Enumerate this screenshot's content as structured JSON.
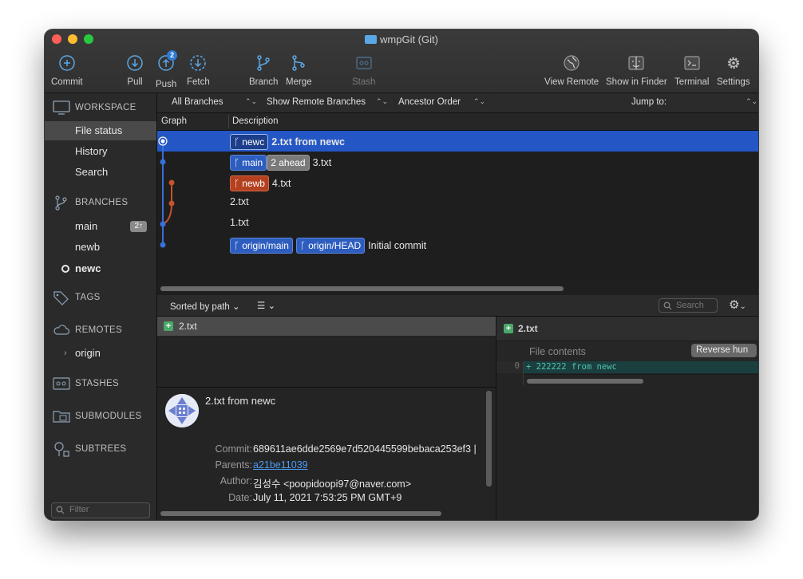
{
  "window": {
    "title": "wmpGit (Git)"
  },
  "toolbar": {
    "commit": "Commit",
    "pull": "Pull",
    "push": "Push",
    "push_badge": "2",
    "fetch": "Fetch",
    "branch": "Branch",
    "merge": "Merge",
    "stash": "Stash",
    "view_remote": "View Remote",
    "show_in_finder": "Show in Finder",
    "terminal": "Terminal",
    "settings": "Settings"
  },
  "sidebar": {
    "workspace": "WORKSPACE",
    "workspace_items": [
      "File status",
      "History",
      "Search"
    ],
    "branches": "BRANCHES",
    "branch_items": [
      {
        "name": "main",
        "badge": "2↑"
      },
      {
        "name": "newb"
      },
      {
        "name": "newc",
        "current": true
      }
    ],
    "tags": "TAGS",
    "remotes": "REMOTES",
    "remote_items": [
      "origin"
    ],
    "stashes": "STASHES",
    "submodules": "SUBMODULES",
    "subtrees": "SUBTREES",
    "filter_placeholder": "Filter"
  },
  "filters": {
    "branches": "All Branches",
    "remote": "Show Remote Branches",
    "order": "Ancestor Order",
    "jump_to": "Jump to:"
  },
  "columns": {
    "graph": "Graph",
    "description": "Description"
  },
  "commits": [
    {
      "tags": [
        {
          "label": "newc",
          "color": "blue"
        }
      ],
      "message": "2.txt from newc",
      "selected": true
    },
    {
      "tags": [
        {
          "label": "main",
          "color": "blue"
        },
        {
          "label": "2 ahead",
          "color": "gray"
        }
      ],
      "message": "3.txt"
    },
    {
      "tags": [
        {
          "label": "newb",
          "color": "red"
        }
      ],
      "message": "4.txt"
    },
    {
      "tags": [],
      "message": "2.txt"
    },
    {
      "tags": [],
      "message": "1.txt"
    },
    {
      "tags": [
        {
          "label": "origin/main",
          "color": "blue"
        },
        {
          "label": "origin/HEAD",
          "color": "blue"
        }
      ],
      "message": "Initial commit"
    }
  ],
  "files_bar": {
    "sort": "Sorted by path",
    "search_placeholder": "Search"
  },
  "files": [
    {
      "name": "2.txt",
      "status": "added"
    }
  ],
  "commit_detail": {
    "title": "2.txt from newc",
    "commit_label": "Commit:",
    "commit": "689611ae6dde2569e7d520445599bebaca253ef3 |",
    "parents_label": "Parents:",
    "parents": "a21be11039",
    "author_label": "Author:",
    "author": "김성수 <poopidoopi97@naver.com>",
    "date_label": "Date:",
    "date": "July 11, 2021 7:53:25 PM GMT+9"
  },
  "diff": {
    "file": "2.txt",
    "header": "File contents",
    "reverse_button": "Reverse hun",
    "line_number": "0",
    "line": "+ 222222 from newc"
  },
  "colors": {
    "accent": "#2457c5",
    "branch_blue": "#2d5dbf",
    "branch_red": "#b3401f",
    "added_green": "#4aa86a"
  }
}
